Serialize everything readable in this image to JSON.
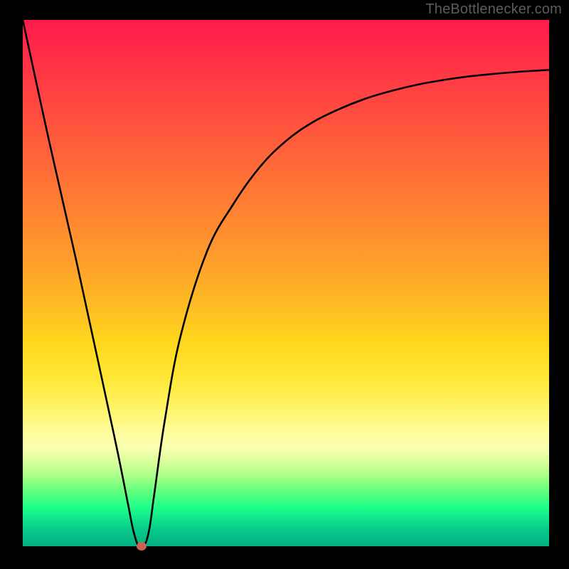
{
  "watermark": "TheBottlenecker.com",
  "chart_data": {
    "type": "line",
    "title": "",
    "xlabel": "",
    "ylabel": "",
    "xlim": [
      0,
      100
    ],
    "ylim": [
      0,
      100
    ],
    "grid": false,
    "series": [
      {
        "name": "bottleneck-curve",
        "x": [
          0,
          5,
          10,
          15,
          18,
          20,
          21,
          22,
          23,
          24,
          25,
          27,
          30,
          35,
          40,
          45,
          50,
          55,
          60,
          65,
          70,
          75,
          80,
          85,
          90,
          95,
          100
        ],
        "y": [
          100,
          77,
          55,
          32,
          18,
          8,
          3,
          0,
          0,
          3,
          10,
          24,
          40,
          56,
          65,
          72,
          77,
          80.5,
          83,
          85,
          86.5,
          87.7,
          88.6,
          89.3,
          89.8,
          90.2,
          90.5
        ]
      }
    ],
    "colors": {
      "curve": "#000000",
      "marker": "#c9635a",
      "gradient_top": "#ff1a4c",
      "gradient_mid": "#ffd61c",
      "gradient_bottom": "#04b082"
    },
    "marker": {
      "x": 22.5,
      "y": 0
    }
  }
}
